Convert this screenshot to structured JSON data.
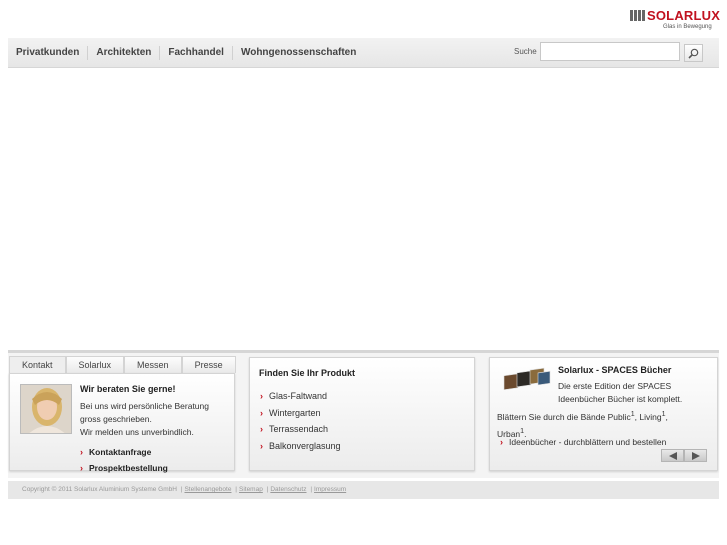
{
  "logo": {
    "name": "SOLARLUX",
    "tagline": "Glas in Bewegung"
  },
  "nav": {
    "items": [
      "Privatkunden",
      "Architekten",
      "Fachhandel",
      "Wohngenossenschaften"
    ],
    "search_label": "Suche",
    "search_value": ""
  },
  "tabs": [
    "Kontakt",
    "Solarlux",
    "Messen",
    "Presse"
  ],
  "contact": {
    "title": "Wir beraten Sie gerne!",
    "text_lines": [
      "Bei uns wird persönliche Beratung",
      "gross geschrieben.",
      "Wir melden uns unverbindlich."
    ],
    "links": [
      "Kontaktanfrage",
      "Prospektbestellung"
    ]
  },
  "product": {
    "title": "Finden Sie Ihr Produkt",
    "items": [
      "Glas-Faltwand",
      "Wintergarten",
      "Terrassendach",
      "Balkonverglasung"
    ]
  },
  "spaces": {
    "title": "Solarlux - SPACES Bücher",
    "text": "Die erste Edition der SPACES Ideenbücher Bücher ist komplett.",
    "text2_a": "Blättern Sie durch die Bände Public",
    "text2_b": ", Living",
    "text2_c": ",",
    "text2_d": "Urban",
    "text2_e": ".",
    "sup": "1",
    "link": "Ideenbücher - durchblättern und bestellen"
  },
  "footer": {
    "copyright": "Copyright © 2011 Solarlux Aluminium Systeme GmbH",
    "links": [
      "Stellenangebote",
      "Sitemap",
      "Datenschutz",
      "Impressum"
    ]
  },
  "colors": {
    "brand_red": "#c1121f",
    "nav_bg": "#ececec",
    "footer_bg": "#e7e7e7"
  },
  "icons": [
    "logo-bars-icon",
    "search-icon",
    "chevron-right-icon",
    "arrow-left-icon",
    "arrow-right-icon"
  ]
}
